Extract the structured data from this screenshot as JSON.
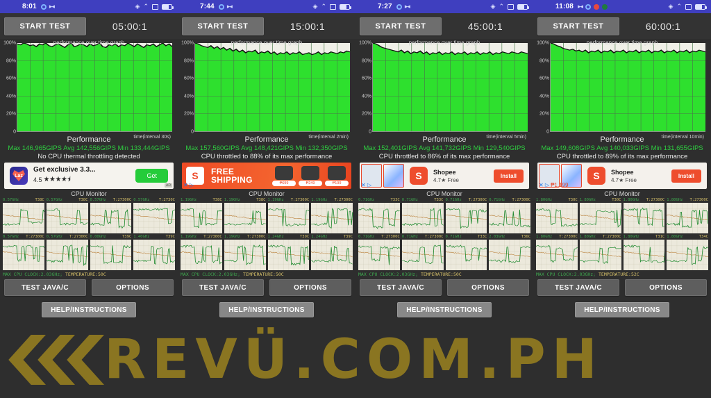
{
  "watermark": {
    "text": "REVÜ.COM.PH"
  },
  "panels": [
    {
      "status": {
        "time": "8:01",
        "icons": [
          "gear-icon",
          "sync-icon",
          "location-icon",
          "wifi-icon",
          "cast-icon",
          "battery-icon"
        ]
      },
      "start_label": "START TEST",
      "timer": "05:00:1",
      "graph": {
        "title": "performance over time graph",
        "x_label": "time(interval 30s)",
        "y_ticks": [
          "100%",
          "80%",
          "60%",
          "40%",
          "20%",
          "0"
        ]
      },
      "performance": {
        "heading": "Performance",
        "max": "Max 146,965GIPS",
        "avg": "Avg 142,556GIPS",
        "min": "Min 133,444GIPS",
        "note": "No CPU thermal throttling detected"
      },
      "ad": {
        "kind": "lazada",
        "icon_text": "Laz",
        "title": "Get exclusive 3.3...",
        "rating": "4.5",
        "stars": "★★★★⯨",
        "cta": "Get",
        "badge": "AD"
      },
      "cpu": {
        "title": "CPU Monitor",
        "cells": [
          {
            "freq": "0.57GHz",
            "temp": "T38C"
          },
          {
            "freq": "0.57GHz",
            "temp": "T38C"
          },
          {
            "freq": "0.57GHz",
            "temp": "T:27300C"
          },
          {
            "freq": "0.57GHz",
            "temp": "T:2730C"
          },
          {
            "freq": "0.57GHz",
            "temp": "T:27300C"
          },
          {
            "freq": "0.57GHz",
            "temp": "T:27300C"
          },
          {
            "freq": "0.00GHz",
            "temp": "T39C"
          },
          {
            "freq": "1.40GHz",
            "temp": "T39C"
          }
        ],
        "status_clock": "MAX CPU CLOCK:2.03GHz;",
        "status_temp": "TEMPERATURE:50C"
      },
      "buttons": {
        "test": "TEST JAVA/C",
        "options": "OPTIONS",
        "help": "HELP/INSTRUCTIONS"
      }
    },
    {
      "status": {
        "time": "7:44",
        "icons": [
          "gear-icon",
          "sync-icon",
          "location-icon",
          "wifi-icon",
          "cast-icon",
          "battery-icon"
        ]
      },
      "start_label": "START TEST",
      "timer": "15:00:1",
      "graph": {
        "title": "performance over time graph",
        "x_label": "time(interval 2min)",
        "y_ticks": [
          "100%",
          "80%",
          "60%",
          "40%",
          "20%",
          "0"
        ]
      },
      "performance": {
        "heading": "Performance",
        "max": "Max 157,560GIPS",
        "avg": "Avg 148,421GIPS",
        "min": "Min 132,350GIPS",
        "note": "CPU throttled to 88% of its max performance"
      },
      "ad": {
        "kind": "shopee-banner",
        "icon_text": "S",
        "title": "FREE SHIPPING",
        "products": [
          {
            "price": "₱699"
          },
          {
            "price": "₱249"
          },
          {
            "price": "₱199"
          }
        ]
      },
      "cpu": {
        "title": "CPU Monitor",
        "cells": [
          {
            "freq": "1.19GHz",
            "temp": "T38C"
          },
          {
            "freq": "1.19GHz",
            "temp": "T38C"
          },
          {
            "freq": "1.19GHz",
            "temp": "T:27300C"
          },
          {
            "freq": "1.19GHz",
            "temp": "T:27300C"
          },
          {
            "freq": "1.19GHz",
            "temp": "T:27300C"
          },
          {
            "freq": "1.19GHz",
            "temp": "T:27300C"
          },
          {
            "freq": "1.24GHz",
            "temp": "T39C"
          },
          {
            "freq": "1.24GHz",
            "temp": "T39C"
          }
        ],
        "status_clock": "MAX CPU CLOCK:2.03GHz;",
        "status_temp": "TEMPERATURE:50C"
      },
      "buttons": {
        "test": "TEST JAVA/C",
        "options": "OPTIONS",
        "help": "HELP/INSTRUCTIONS"
      }
    },
    {
      "status": {
        "time": "7:27",
        "icons": [
          "gear-icon",
          "sync-icon",
          "location-icon",
          "wifi-icon",
          "cast-icon",
          "battery-icon"
        ]
      },
      "start_label": "START TEST",
      "timer": "45:00:1",
      "graph": {
        "title": "performance over time graph",
        "x_label": "time(interval 5min)",
        "y_ticks": [
          "100%",
          "80%",
          "60%",
          "40%",
          "20%",
          "0"
        ]
      },
      "performance": {
        "heading": "Performance",
        "max": "Max 152,401GIPS",
        "avg": "Avg 141,732GIPS",
        "min": "Min 129,540GIPS",
        "note": "CPU throttled to 86% of its max performance"
      },
      "ad": {
        "kind": "shopee-install",
        "icon_text": "S",
        "title": "Shopee",
        "sub": "4.7★  Free",
        "cta": "Install"
      },
      "cpu": {
        "title": "CPU Monitor",
        "cells": [
          {
            "freq": "0.71GHz",
            "temp": "T33C"
          },
          {
            "freq": "0.71GHz",
            "temp": "T33C"
          },
          {
            "freq": "0.71GHz",
            "temp": "T:27300C"
          },
          {
            "freq": "0.71GHz",
            "temp": "T:27300C"
          },
          {
            "freq": "0.71GHz",
            "temp": "T:27300C"
          },
          {
            "freq": "0.71GHz",
            "temp": "T:27300C"
          },
          {
            "freq": "0.71GHz",
            "temp": "T33C"
          },
          {
            "freq": "2.03GHz",
            "temp": "T36C"
          }
        ],
        "status_clock": "MAX CPU CLOCK:2.03GHz;",
        "status_temp": "TEMPERATURE:50C"
      },
      "buttons": {
        "test": "TEST JAVA/C",
        "options": "OPTIONS",
        "help": "HELP/INSTRUCTIONS"
      }
    },
    {
      "status": {
        "time": "11:08",
        "icons": [
          "sync-icon",
          "gear-icon",
          "record-icon",
          "dot-green-icon",
          "location-icon",
          "wifi-icon",
          "cast-icon",
          "battery-icon"
        ]
      },
      "start_label": "START TEST",
      "timer": "60:00:1",
      "graph": {
        "title": "performance over time graph",
        "x_label": "time(interval 10min)",
        "y_ticks": [
          "100%",
          "80%",
          "60%",
          "40%",
          "20%",
          "0"
        ]
      },
      "performance": {
        "heading": "Performance",
        "max": "Max 149,608GIPS",
        "avg": "Avg 140,033GIPS",
        "min": "Min 131,655GIPS",
        "note": "CPU throttled to 89% of its max performance"
      },
      "ad": {
        "kind": "shopee-install",
        "icon_text": "S",
        "title": "Shopee",
        "sub": "4.7★  Free",
        "cta": "Install",
        "price_tag": "₱1,199"
      },
      "cpu": {
        "title": "CPU Monitor",
        "cells": [
          {
            "freq": "1.80GHz",
            "temp": "T30C"
          },
          {
            "freq": "1.80GHz",
            "temp": "T30C"
          },
          {
            "freq": "1.80GHz",
            "temp": "T:27300C"
          },
          {
            "freq": "1.80GHz",
            "temp": "T:27300C"
          },
          {
            "freq": "1.80GHz",
            "temp": "T:27300C"
          },
          {
            "freq": "1.80GHz",
            "temp": "T:27300C"
          },
          {
            "freq": "1.80GHz",
            "temp": "T31C"
          },
          {
            "freq": "1.80GHz",
            "temp": "T34C"
          }
        ],
        "status_clock": "MAX CPU CLOCK:2.03GHz;",
        "status_temp": "TEMPERATURE:52C"
      },
      "buttons": {
        "test": "TEST JAVA/C",
        "options": "OPTIONS",
        "help": "HELP/INSTRUCTIONS"
      }
    }
  ],
  "chart_data": [
    {
      "type": "area",
      "title": "performance over time graph",
      "xlabel": "time(interval 30s)",
      "ylabel": "",
      "ylim": [
        0,
        100
      ],
      "yticks": [
        0,
        20,
        40,
        60,
        80,
        100
      ],
      "series": [
        {
          "name": "performance %",
          "values": [
            99,
            98,
            100,
            99,
            97,
            98,
            96,
            99,
            98,
            100,
            97,
            96,
            98,
            99,
            97,
            95,
            98,
            100,
            96,
            97,
            99,
            98,
            96,
            99,
            97,
            98,
            100,
            96,
            95,
            98,
            97,
            99,
            96,
            98,
            97,
            100,
            98,
            96,
            99,
            97,
            95,
            98,
            97,
            99,
            96,
            98,
            100,
            97,
            99,
            96
          ]
        }
      ]
    },
    {
      "type": "area",
      "title": "performance over time graph",
      "xlabel": "time(interval 2min)",
      "ylabel": "",
      "ylim": [
        0,
        100
      ],
      "yticks": [
        0,
        20,
        40,
        60,
        80,
        100
      ],
      "series": [
        {
          "name": "performance %",
          "values": [
            100,
            99,
            97,
            96,
            95,
            97,
            94,
            96,
            93,
            95,
            92,
            94,
            91,
            93,
            90,
            92,
            89,
            91,
            90,
            92,
            88,
            90,
            89,
            91,
            88,
            90,
            87,
            89,
            88,
            90,
            87,
            89,
            88,
            90,
            87,
            88,
            89,
            87,
            88,
            90,
            87,
            89,
            88,
            90,
            89,
            88,
            90,
            89,
            91,
            90
          ]
        }
      ]
    },
    {
      "type": "area",
      "title": "performance over time graph",
      "xlabel": "time(interval 5min)",
      "ylabel": "",
      "ylim": [
        0,
        100
      ],
      "yticks": [
        0,
        20,
        40,
        60,
        80,
        100
      ],
      "series": [
        {
          "name": "performance %",
          "values": [
            100,
            99,
            97,
            95,
            94,
            93,
            92,
            91,
            90,
            92,
            89,
            91,
            88,
            90,
            89,
            91,
            88,
            90,
            87,
            89,
            88,
            90,
            87,
            89,
            88,
            90,
            87,
            89,
            88,
            90,
            87,
            89,
            88,
            90,
            87,
            89,
            88,
            90,
            87,
            89,
            88,
            90,
            89,
            88,
            90,
            89,
            88,
            90,
            89,
            88
          ]
        }
      ]
    },
    {
      "type": "area",
      "title": "performance over time graph",
      "xlabel": "time(interval 10min)",
      "ylabel": "",
      "ylim": [
        0,
        100
      ],
      "yticks": [
        0,
        20,
        40,
        60,
        80,
        100
      ],
      "series": [
        {
          "name": "performance %",
          "values": [
            100,
            99,
            97,
            96,
            94,
            93,
            92,
            93,
            91,
            92,
            90,
            92,
            89,
            91,
            90,
            92,
            89,
            91,
            90,
            92,
            89,
            91,
            90,
            92,
            89,
            91,
            90,
            92,
            89,
            91,
            90,
            92,
            89,
            91,
            90,
            92,
            89,
            91,
            90,
            92,
            89,
            91,
            90,
            92,
            89,
            91,
            90,
            92,
            91,
            90
          ]
        }
      ]
    }
  ]
}
